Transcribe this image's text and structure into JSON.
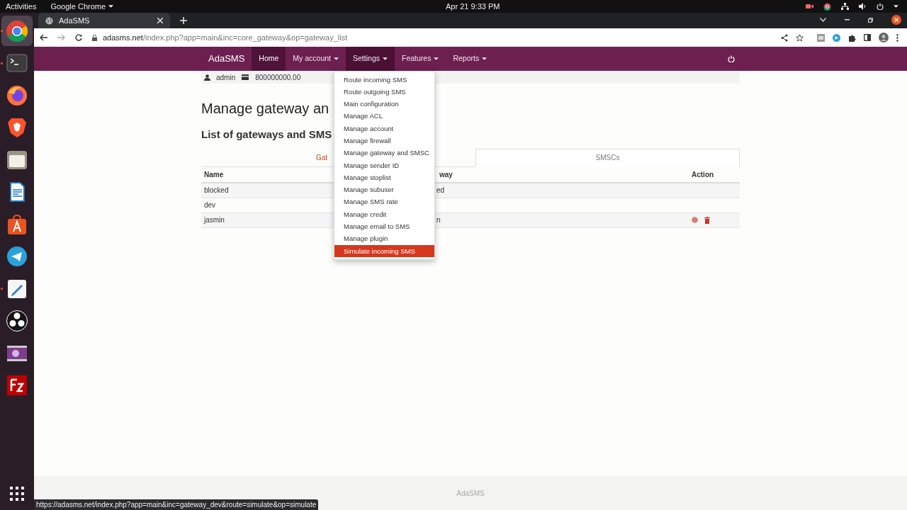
{
  "system_bar": {
    "activities": "Activities",
    "app_menu": "Google Chrome",
    "clock": "Apr 21  9:33 PM"
  },
  "dock": [
    {
      "kind": "chrome",
      "running": true,
      "focused": true
    },
    {
      "kind": "terminal",
      "running": true,
      "focused": false
    },
    {
      "kind": "firefox",
      "running": false,
      "focused": false
    },
    {
      "kind": "brave",
      "running": false,
      "focused": false
    },
    {
      "kind": "files",
      "running": false,
      "focused": false
    },
    {
      "kind": "writer",
      "running": false,
      "focused": false
    },
    {
      "kind": "software",
      "running": false,
      "focused": false
    },
    {
      "kind": "telegram",
      "running": false,
      "focused": false
    },
    {
      "kind": "editor",
      "running": true,
      "focused": false
    },
    {
      "kind": "obs",
      "running": false,
      "focused": false
    },
    {
      "kind": "video",
      "running": false,
      "focused": false
    },
    {
      "kind": "filezilla",
      "running": false,
      "focused": false
    }
  ],
  "browser": {
    "tab_title": "AdaSMS",
    "url_host": "adasms.net",
    "url_path": "/index.php?app=main&inc=core_gateway&op=gateway_list",
    "status_url": "https://adasms.net/index.php?app=main&inc=gateway_dev&route=simulate&op=simulate"
  },
  "navbar": {
    "brand": "AdaSMS",
    "items": [
      {
        "label": "Home",
        "dropdown": false,
        "selected": true,
        "open": false
      },
      {
        "label": "My account",
        "dropdown": true,
        "selected": false,
        "open": false
      },
      {
        "label": "Settings",
        "dropdown": true,
        "selected": false,
        "open": true
      },
      {
        "label": "Features",
        "dropdown": true,
        "selected": false,
        "open": false
      },
      {
        "label": "Reports",
        "dropdown": true,
        "selected": false,
        "open": false
      }
    ]
  },
  "user_bar": {
    "username": "admin",
    "credit": "800000000.00"
  },
  "settings_menu": [
    {
      "label": "Route incoming SMS",
      "highlighted": false
    },
    {
      "label": "Route outgoing SMS",
      "highlighted": false
    },
    {
      "label": "Main configuration",
      "highlighted": false
    },
    {
      "label": "Manage ACL",
      "highlighted": false
    },
    {
      "label": "Manage account",
      "highlighted": false
    },
    {
      "label": "Manage firewall",
      "highlighted": false
    },
    {
      "label": "Manage gateway and SMSC",
      "highlighted": false
    },
    {
      "label": "Manage sender ID",
      "highlighted": false
    },
    {
      "label": "Manage stoplist",
      "highlighted": false
    },
    {
      "label": "Manage subuser",
      "highlighted": false
    },
    {
      "label": "Manage SMS rate",
      "highlighted": false
    },
    {
      "label": "Manage credit",
      "highlighted": false
    },
    {
      "label": "Manage email to SMS",
      "highlighted": false
    },
    {
      "label": "Manage plugin",
      "highlighted": false
    },
    {
      "label": "Simulate incoming SMS",
      "highlighted": true
    }
  ],
  "page": {
    "title": "Manage gateway an",
    "subtitle": "List of gateways and SMS",
    "tabs": [
      {
        "label": "Gat",
        "selected": false
      },
      {
        "label": "SMSCs",
        "selected": true
      }
    ],
    "table": {
      "columns": [
        "Name",
        "way",
        "Action"
      ],
      "rows": [
        {
          "name": "blocked",
          "gateway": "ed",
          "actions": false
        },
        {
          "name": "dev",
          "actions": false
        },
        {
          "name": "jasmin",
          "gateway": "n",
          "actions": true
        }
      ]
    }
  },
  "footer": "AdaSMS"
}
